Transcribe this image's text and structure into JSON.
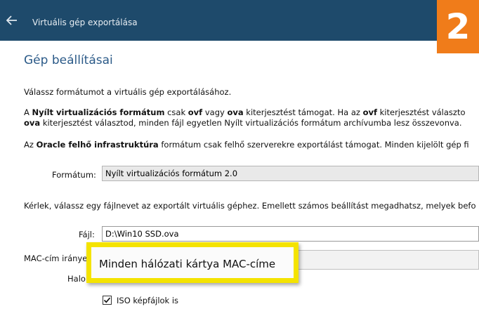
{
  "window": {
    "title": "Virtuális gép exportálása"
  },
  "badge": {
    "number": "2",
    "color": "#f07c1a"
  },
  "page": {
    "heading": "Gép beállításai"
  },
  "description": {
    "line1": "Válassz formátumot a virtuális gép exportálásához.",
    "p2_prefix": "A ",
    "p2_bold1": "Nyílt virtualizációs formátum",
    "p2_mid1": " csak ",
    "p2_bold2": "ovf",
    "p2_mid2": " vagy ",
    "p2_bold3": "ova",
    "p2_mid3": " kiterjesztést támogat. Ha az ",
    "p2_bold4": "ovf",
    "p2_end": " kiterjesztést választo",
    "p2_line2_bold": "ova",
    "p2_line2_rest": " kiterjesztést választod, minden fájl egyetlen Nyílt virtualizációs formátum archívumba lesz összevonva.",
    "p3_prefix": "Az ",
    "p3_bold": "Oracle felhő infrastruktúra",
    "p3_rest": " formátum csak felhő szerverekre exportálást támogat. Minden kijelölt gép fi",
    "line4": "Kérlek, válassz egy fájlnevet az exportált virtuális géphez. Emellett számos beállítást megadhatsz, melyek befo"
  },
  "format": {
    "label": "Formátum:",
    "value": "Nyílt virtualizációs formátum 2.0"
  },
  "file": {
    "label": "Fájl:",
    "value": "D:\\Win10 SSD.ova"
  },
  "mac": {
    "label": "MAC-cím iránye",
    "selected": "Minden hálózati kártya MAC-címe"
  },
  "extra": {
    "label_partial": "Halo"
  },
  "iso": {
    "label": "ISO képfájlok is",
    "checked": true
  }
}
